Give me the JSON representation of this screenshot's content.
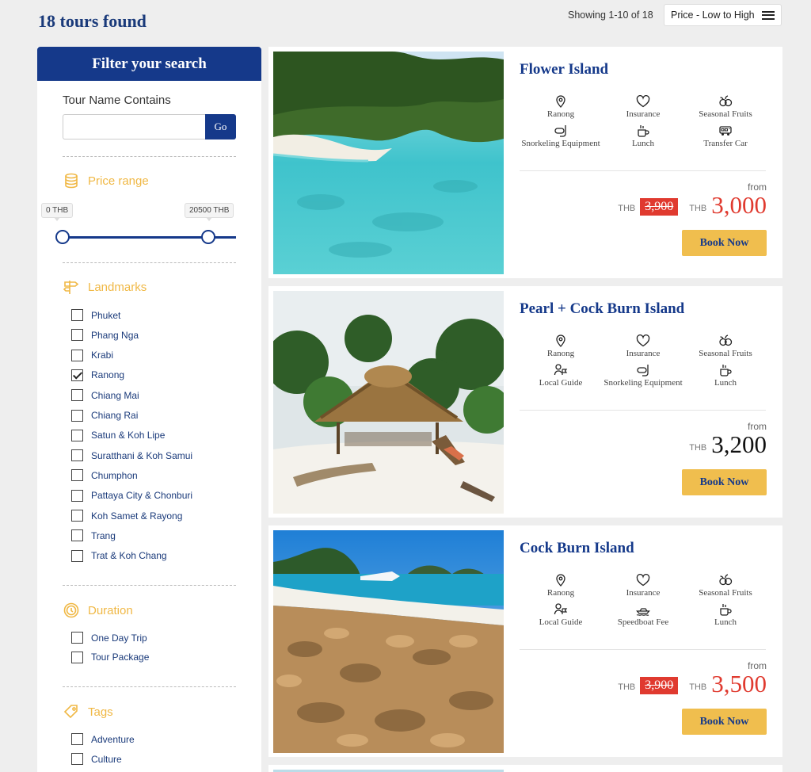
{
  "header": {
    "results_title": "18 tours found",
    "showing": "Showing 1-10 of 18",
    "sort_label": "Price - Low to High"
  },
  "sidebar": {
    "title": "Filter your search",
    "tour_name_label": "Tour Name Contains",
    "tour_name_value": "",
    "go_label": "Go",
    "price_range": {
      "label": "Price range",
      "min_label": "0 THB",
      "max_label": "20500 THB",
      "min_value": 0,
      "max_value": 20500
    },
    "landmarks": {
      "label": "Landmarks",
      "items": [
        {
          "label": "Phuket",
          "checked": false
        },
        {
          "label": "Phang Nga",
          "checked": false
        },
        {
          "label": "Krabi",
          "checked": false
        },
        {
          "label": "Ranong",
          "checked": true
        },
        {
          "label": "Chiang Mai",
          "checked": false
        },
        {
          "label": "Chiang Rai",
          "checked": false
        },
        {
          "label": "Satun & Koh Lipe",
          "checked": false
        },
        {
          "label": "Suratthani & Koh Samui",
          "checked": false
        },
        {
          "label": "Chumphon",
          "checked": false
        },
        {
          "label": "Pattaya City & Chonburi",
          "checked": false
        },
        {
          "label": "Koh Samet & Rayong",
          "checked": false
        },
        {
          "label": "Trang",
          "checked": false
        },
        {
          "label": "Trat & Koh Chang",
          "checked": false
        }
      ]
    },
    "duration": {
      "label": "Duration",
      "items": [
        {
          "label": "One Day Trip",
          "checked": false
        },
        {
          "label": "Tour Package",
          "checked": false
        }
      ]
    },
    "tags": {
      "label": "Tags",
      "items": [
        {
          "label": "Adventure",
          "checked": false
        },
        {
          "label": "Culture",
          "checked": false
        }
      ]
    }
  },
  "tours": [
    {
      "title": "Flower Island",
      "features": [
        {
          "icon": "location-pin-icon",
          "label": "Ranong"
        },
        {
          "icon": "heart-shield-icon",
          "label": "Insurance"
        },
        {
          "icon": "fruits-icon",
          "label": "Seasonal Fruits"
        },
        {
          "icon": "snorkel-icon",
          "label": "Snorkeling Equipment"
        },
        {
          "icon": "lunch-icon",
          "label": "Lunch"
        },
        {
          "icon": "van-icon",
          "label": "Transfer Car"
        }
      ],
      "from_label": "from",
      "currency": "THB",
      "old_price": "3,900",
      "price": "3,000",
      "book_label": "Book Now"
    },
    {
      "title": "Pearl + Cock Burn Island",
      "features": [
        {
          "icon": "location-pin-icon",
          "label": "Ranong"
        },
        {
          "icon": "heart-shield-icon",
          "label": "Insurance"
        },
        {
          "icon": "fruits-icon",
          "label": "Seasonal Fruits"
        },
        {
          "icon": "guide-icon",
          "label": "Local Guide"
        },
        {
          "icon": "snorkel-icon",
          "label": "Snorkeling Equipment"
        },
        {
          "icon": "lunch-icon",
          "label": "Lunch"
        }
      ],
      "from_label": "from",
      "currency": "THB",
      "old_price": "",
      "price": "3,200",
      "book_label": "Book Now"
    },
    {
      "title": "Cock Burn Island",
      "features": [
        {
          "icon": "location-pin-icon",
          "label": "Ranong"
        },
        {
          "icon": "heart-shield-icon",
          "label": "Insurance"
        },
        {
          "icon": "fruits-icon",
          "label": "Seasonal Fruits"
        },
        {
          "icon": "guide-icon",
          "label": "Local Guide"
        },
        {
          "icon": "speedboat-icon",
          "label": "Speedboat Fee"
        },
        {
          "icon": "lunch-icon",
          "label": "Lunch"
        }
      ],
      "from_label": "from",
      "currency": "THB",
      "old_price": "3,900",
      "price": "3,500",
      "book_label": "Book Now"
    }
  ],
  "colors": {
    "brand_blue": "#15398a",
    "accent_yellow": "#f0be4e",
    "price_red": "#e03a2f"
  }
}
